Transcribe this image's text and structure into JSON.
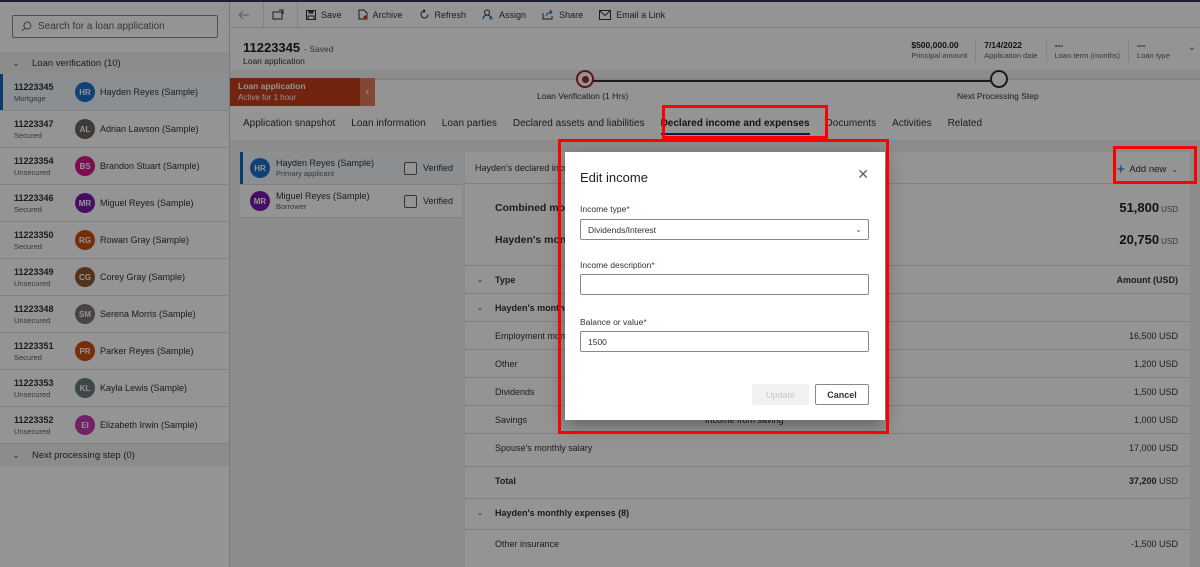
{
  "left_pane": {
    "search_placeholder": "Search for a loan application",
    "group1": "Loan verification (10)",
    "group2": "Next processing step (0)",
    "applications": [
      {
        "id": "11223345",
        "type": "Mortgage",
        "initials": "HR",
        "name": "Hayden Reyes (Sample)",
        "color": "#1e6fd0",
        "selected": true
      },
      {
        "id": "11223347",
        "type": "Secured",
        "initials": "AL",
        "name": "Adrian Lawson (Sample)",
        "color": "#6b6461"
      },
      {
        "id": "11223354",
        "type": "Unsecured",
        "initials": "BS",
        "name": "Brandon Stuart (Sample)",
        "color": "#d6198a"
      },
      {
        "id": "11223346",
        "type": "Secured",
        "initials": "MR",
        "name": "Miguel Reyes (Sample)",
        "color": "#7719aa"
      },
      {
        "id": "11223350",
        "type": "Secured",
        "initials": "RG",
        "name": "Rowan Gray (Sample)",
        "color": "#ca5010"
      },
      {
        "id": "11223349",
        "type": "Unsecured",
        "initials": "CG",
        "name": "Corey Gray (Sample)",
        "color": "#8e562e"
      },
      {
        "id": "11223348",
        "type": "Unsecured",
        "initials": "SM",
        "name": "Serena Morris (Sample)",
        "color": "#7a7574"
      },
      {
        "id": "11223351",
        "type": "Secured",
        "initials": "PR",
        "name": "Parker Reyes (Sample)",
        "color": "#ca5010"
      },
      {
        "id": "11223353",
        "type": "Unsecured",
        "initials": "KL",
        "name": "Kayla Lewis (Sample)",
        "color": "#69797e"
      },
      {
        "id": "11223352",
        "type": "Unsecured",
        "initials": "EI",
        "name": "Elizabeth Irwin (Sample)",
        "color": "#c239b3"
      }
    ]
  },
  "commands": {
    "save": "Save",
    "archive": "Archive",
    "refresh": "Refresh",
    "assign": "Assign",
    "share": "Share",
    "email": "Email a Link"
  },
  "header": {
    "record_id": "11223345",
    "saved_status": "- Saved",
    "entity": "Loan application",
    "fields": [
      {
        "value": "$500,000.00",
        "label": "Principal amount"
      },
      {
        "value": "7/14/2022",
        "label": "Application date"
      },
      {
        "value": "---",
        "label": "Loan term (months)"
      },
      {
        "value": "---",
        "label": "Loan type"
      }
    ]
  },
  "process": {
    "flag_title": "Loan application",
    "flag_sub": "Active for 1 hour",
    "stage1": "Loan Verification  (1 Hrs)",
    "stage2": "Next Processing Step"
  },
  "tabs": [
    "Application snapshot",
    "Loan information",
    "Loan parties",
    "Declared assets and liabilities",
    "Declared income and expenses",
    "Documents",
    "Activities",
    "Related"
  ],
  "active_tab": "Declared income and expenses",
  "parties": [
    {
      "initials": "HR",
      "name": "Hayden Reyes (Sample)",
      "role": "Primary applicant",
      "color": "#1e6fd0",
      "verified_label": "Verified",
      "verified": false
    },
    {
      "initials": "MR",
      "name": "Miguel Reyes (Sample)",
      "role": "Borrower",
      "color": "#7719aa",
      "verified_label": "Verified",
      "verified": false
    }
  ],
  "detail": {
    "header": "Hayden's declared income and expenses",
    "add_new": "Add new",
    "combined_label": "Combined monthly income",
    "combined_value": "51,800",
    "hayden_label": "Hayden's monthly income",
    "hayden_value": "20,750",
    "currency": "USD",
    "col_type": "Type",
    "col_amount": "Amount (USD)",
    "income_group": "Hayden's monthly income",
    "rows": [
      {
        "label": "Employment monthly income",
        "desc": "",
        "amount": "16,500 USD"
      },
      {
        "label": "Other",
        "desc": "",
        "amount": "1,200 USD"
      },
      {
        "label": "Dividends",
        "desc": "",
        "amount": "1,500 USD"
      },
      {
        "label": "Savings",
        "desc": "Income from saving",
        "amount": "1,000 USD"
      },
      {
        "label": "Spouse's monthly salary",
        "desc": "",
        "amount": "17,000 USD"
      }
    ],
    "total_label": "Total",
    "total_value": "37,200",
    "expenses_group": "Hayden's monthly expenses (8)",
    "expense_rows": [
      {
        "label": "Other insurance",
        "amount": "-1,500 USD"
      }
    ]
  },
  "dialog": {
    "title": "Edit income",
    "income_type_label": "Income type",
    "income_type_value": "Dividends/Interest",
    "description_label": "Income description",
    "description_value": "",
    "balance_label": "Balance or value",
    "balance_value": "1500",
    "required_mark": "*",
    "update": "Update",
    "cancel": "Cancel"
  }
}
